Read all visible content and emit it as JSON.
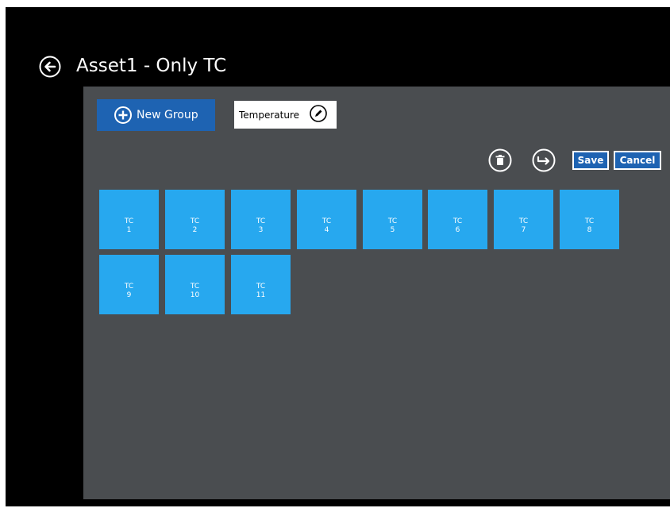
{
  "header": {
    "title": "Asset1 - Only TC",
    "back_icon": "back-arrow-icon"
  },
  "toolbar": {
    "new_group_label": "New Group",
    "group_name_value": "Temperature",
    "edit_icon": "pencil-icon",
    "delete_icon": "trash-icon",
    "move_icon": "move-arrow-icon",
    "save_label": "Save",
    "cancel_label": "Cancel"
  },
  "tiles": [
    {
      "label": "TC",
      "number": "1"
    },
    {
      "label": "TC",
      "number": "2"
    },
    {
      "label": "TC",
      "number": "3"
    },
    {
      "label": "TC",
      "number": "4"
    },
    {
      "label": "TC",
      "number": "5"
    },
    {
      "label": "TC",
      "number": "6"
    },
    {
      "label": "TC",
      "number": "7"
    },
    {
      "label": "TC",
      "number": "8"
    },
    {
      "label": "TC",
      "number": "9"
    },
    {
      "label": "TC",
      "number": "10"
    },
    {
      "label": "TC",
      "number": "11"
    }
  ],
  "colors": {
    "background": "#000000",
    "panel": "#4a4d50",
    "accent": "#1e63b2",
    "tile": "#27a8ef"
  }
}
